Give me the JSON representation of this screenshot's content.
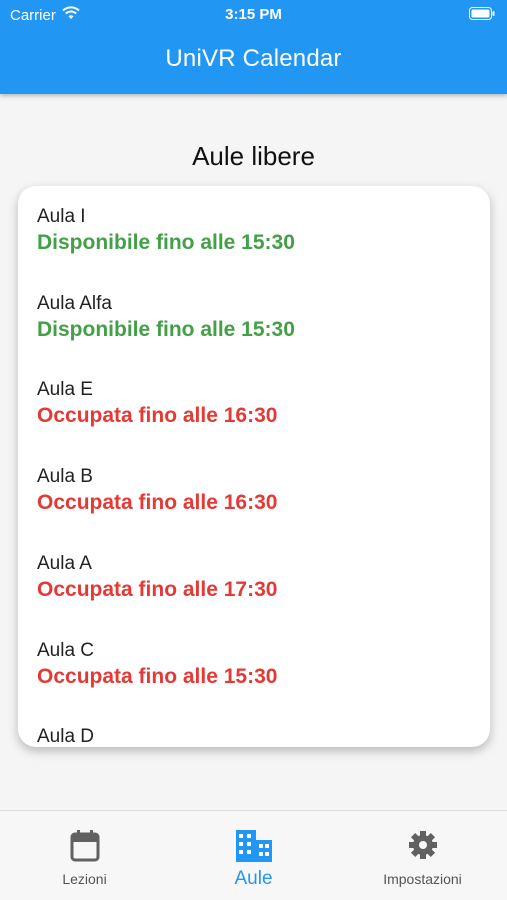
{
  "status_bar": {
    "carrier": "Carrier",
    "time": "3:15 PM"
  },
  "app_bar": {
    "title": "UniVR Calendar"
  },
  "page": {
    "heading": "Aule libere"
  },
  "rooms": [
    {
      "name": "Aula I",
      "status": "Disponibile fino alle 15:30",
      "state": "free"
    },
    {
      "name": "Aula Alfa",
      "status": "Disponibile fino alle 15:30",
      "state": "free"
    },
    {
      "name": "Aula E",
      "status": "Occupata fino alle 16:30",
      "state": "busy"
    },
    {
      "name": "Aula B",
      "status": "Occupata fino alle 16:30",
      "state": "busy"
    },
    {
      "name": "Aula A",
      "status": "Occupata fino alle 17:30",
      "state": "busy"
    },
    {
      "name": "Aula C",
      "status": "Occupata fino alle 15:30",
      "state": "busy"
    },
    {
      "name": "Aula D",
      "status": "",
      "state": "unknown"
    }
  ],
  "bottom_nav": {
    "tabs": [
      {
        "label": "Lezioni",
        "icon": "calendar-icon",
        "active": false
      },
      {
        "label": "Aule",
        "icon": "building-icon",
        "active": true
      },
      {
        "label": "Impostazioni",
        "icon": "gear-icon",
        "active": false
      }
    ]
  },
  "colors": {
    "primary": "#2196F3",
    "free": "#43a047",
    "busy": "#e53935"
  }
}
